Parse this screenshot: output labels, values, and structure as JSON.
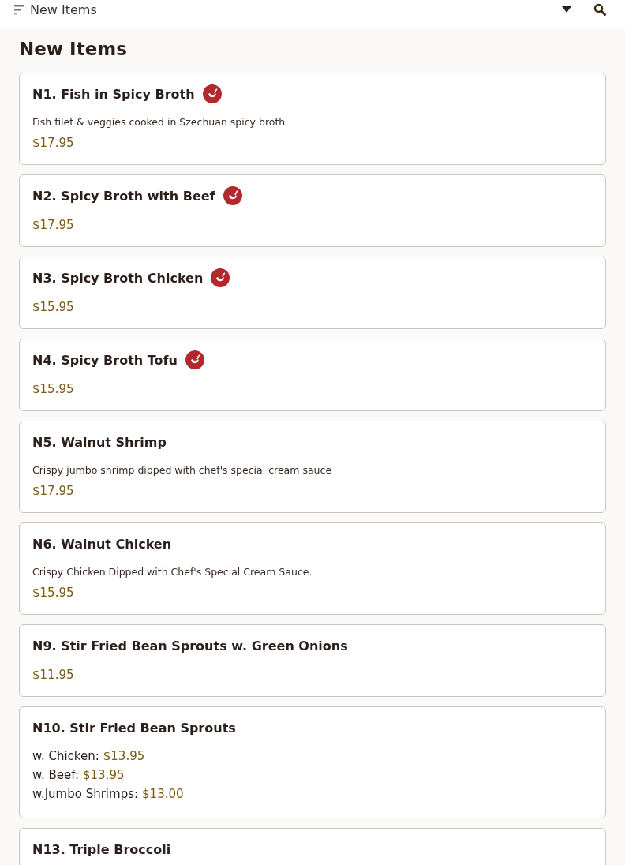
{
  "top_bar": {
    "category": "New Items"
  },
  "section_title": "New Items",
  "items": [
    {
      "name": "N1. Fish in Spicy Broth",
      "spicy": true,
      "description": "Fish filet & veggies cooked in Szechuan spicy broth",
      "price": "$17.95"
    },
    {
      "name": "N2. Spicy Broth with Beef",
      "spicy": true,
      "price": "$17.95"
    },
    {
      "name": "N3. Spicy Broth Chicken",
      "spicy": true,
      "price": "$15.95"
    },
    {
      "name": "N4. Spicy Broth Tofu",
      "spicy": true,
      "price": "$15.95"
    },
    {
      "name": "N5. Walnut Shrimp",
      "spicy": false,
      "description": "Crispy jumbo shrimp dipped with chef's special cream sauce",
      "price": "$17.95"
    },
    {
      "name": "N6. Walnut Chicken",
      "spicy": false,
      "description": "Crispy Chicken Dipped with Chef's Special Cream Sauce.",
      "price": "$15.95"
    },
    {
      "name": "N9. Stir Fried Bean Sprouts w. Green Onions",
      "spicy": false,
      "price": "$11.95"
    },
    {
      "name": "N10. Stir Fried Bean Sprouts",
      "spicy": false,
      "options": [
        {
          "label": "w. Chicken:",
          "price": "$13.95"
        },
        {
          "label": "w. Beef:",
          "price": "$13.95"
        },
        {
          "label": "w.Jumbo Shrimps:",
          "price": "$13.00"
        }
      ]
    },
    {
      "name": "N13. Triple Broccoli",
      "spicy": false
    }
  ]
}
